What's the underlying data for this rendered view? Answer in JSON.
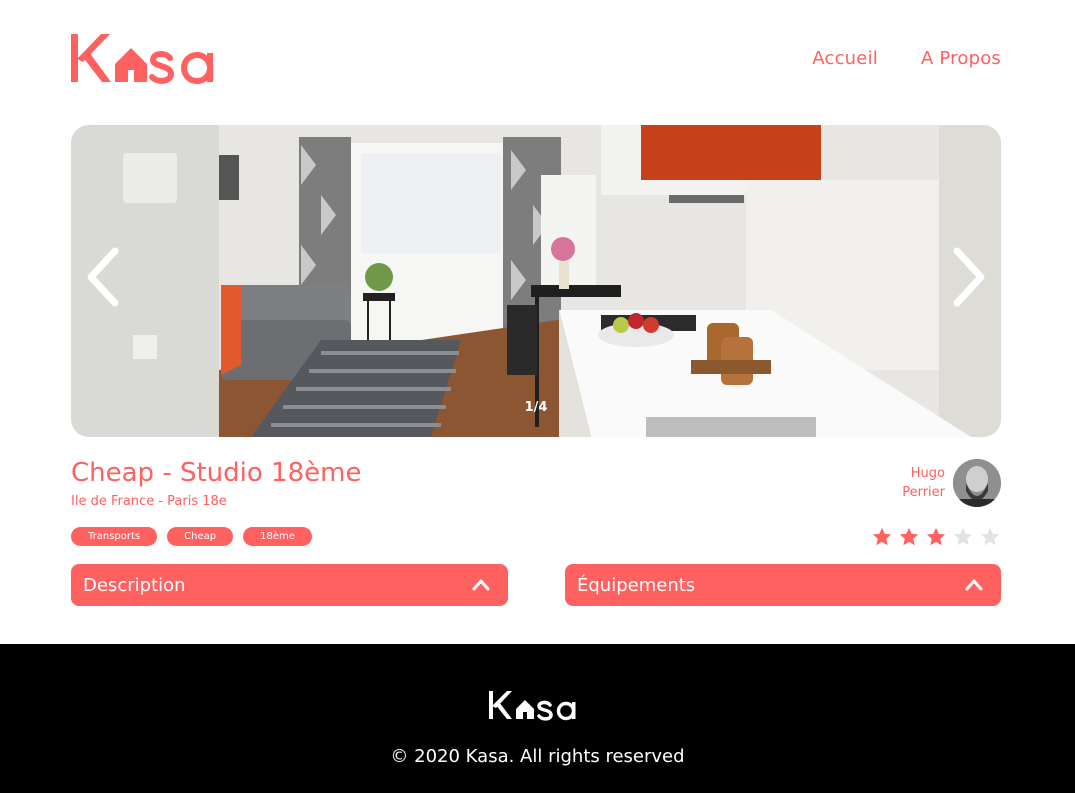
{
  "brand": {
    "name": "Kasa",
    "accent_color": "#FF6060"
  },
  "nav": {
    "home": "Accueil",
    "about": "A Propos"
  },
  "carousel": {
    "counter": "1/4"
  },
  "listing": {
    "title": "Cheap - Studio 18ème",
    "location": "Ile de France - Paris 18e",
    "tags": [
      "Transports",
      "Cheap",
      "18ème"
    ],
    "host": {
      "first_name": "Hugo",
      "last_name": "Perrier"
    },
    "rating": 3,
    "rating_max": 5
  },
  "collapses": {
    "description": "Description",
    "equipment": "Équipements"
  },
  "footer": {
    "copyright": "© 2020 Kasa. All rights reserved"
  },
  "icons": {
    "prev": "chevron-left-icon",
    "next": "chevron-right-icon",
    "toggle": "chevron-up-icon",
    "star": "star-icon"
  }
}
